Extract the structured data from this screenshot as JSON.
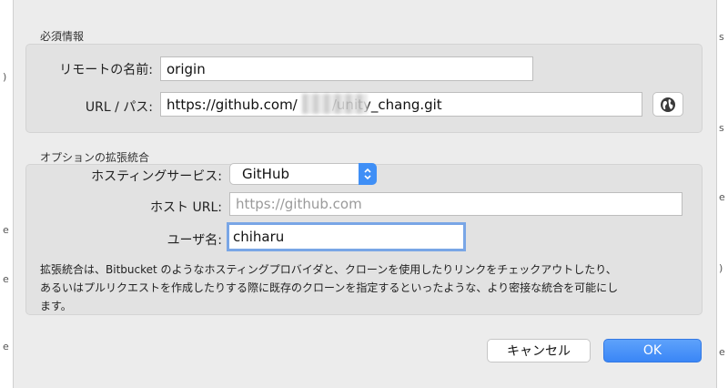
{
  "required": {
    "section_title": "必須情報",
    "remote_name_label": "リモートの名前:",
    "remote_name_value": "origin",
    "url_label": "URL / パス:",
    "url_value": "https://github.com/        /unity_chang.git"
  },
  "optional": {
    "section_title": "オプションの拡張統合",
    "hosting_label": "ホスティングサービス:",
    "hosting_value": "GitHub",
    "host_url_label": "ホスト URL:",
    "host_url_placeholder": "https://github.com",
    "username_label": "ユーザ名:",
    "username_value": "chiharu",
    "description_line1": "拡張統合は、Bitbucket のようなホスティングプロバイダと、クローンを使用したりリンクをチェックアウトしたり、",
    "description_line2": "あるいはプルリクエストを作成したりする際に既存のクローンを指定するといったような、より密接な統合を可能にし",
    "description_line3": "ます。"
  },
  "buttons": {
    "cancel_label": "キャンセル",
    "ok_label": "OK"
  },
  "icons": {
    "globe": "globe-icon",
    "select_arrows": "chevron-up-down-icon"
  },
  "colors": {
    "accent": "#3a86f6",
    "focus_ring": "#79a6e6",
    "dialog_bg": "#ececec",
    "group_bg": "#e2e2e2"
  }
}
